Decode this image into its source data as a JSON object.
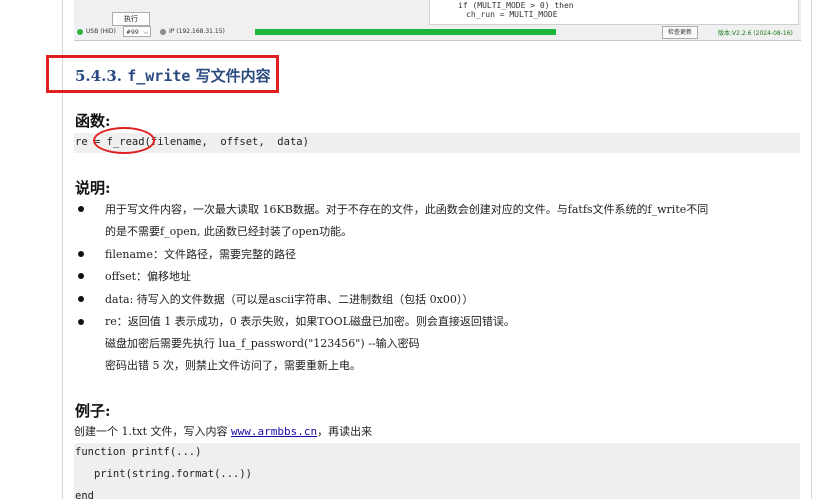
{
  "screenshot": {
    "execute_button": "执行",
    "code_lines": [
      "if (MULTI_MODE > 0) then",
      "ch_run = MULTI_MODE"
    ],
    "status": {
      "usb_label": "USB (HID)",
      "device_value": "#99",
      "ip_label": "IP (192.168.31.15)",
      "progress_fraction": 1.0,
      "check_update_label": "检查更新",
      "version_label": "版本:V2.2.6 (2024-08-16)",
      "usb_color": "#2bb34a",
      "ip_color": "#8a8a8a"
    }
  },
  "section": {
    "number": "5.4.3.",
    "func": "f_write",
    "title_rest": "写文件内容"
  },
  "function_heading": "函数:",
  "signature": {
    "prefix": "re = ",
    "func": "f_read",
    "args": "(filename,  offset,  data)"
  },
  "description_heading": "说明:",
  "bullets": [
    {
      "lines": [
        "用于写文件内容，一次最大读取 16KB数据。对于不存在的文件，此函数会创建对应的文件。与fatfs文件系统的f_write不同",
        "的是不需要f_open, 此函数已经封装了open功能。"
      ]
    },
    {
      "lines": [
        "filename：文件路径，需要完整的路径"
      ]
    },
    {
      "lines": [
        "offset：偏移地址"
      ]
    },
    {
      "lines": [
        "data: 待写入的文件数据（可以是ascii字符串、二进制数组（包括 0x00））"
      ]
    },
    {
      "lines": [
        "re：返回值 1 表示成功，0 表示失败，如果TOOL磁盘已加密。则会直接返回错误。",
        "磁盘加密后需要先执行 lua_f_password(\"123456\") --输入密码",
        "密码出错 5 次，则禁止文件访问了，需要重新上电。"
      ]
    }
  ],
  "example_heading": "例子:",
  "example_intro": {
    "before": "创建一个 1.txt 文件，写入内容 ",
    "link": "www.armbbs.cn",
    "after": "，再读出来"
  },
  "example_code": [
    "function printf(...)",
    "   print(string.format(...))",
    "end"
  ],
  "colors": {
    "annotation_red": "#e02020",
    "section_title_blue": "#2b4a80",
    "code_background": "#efefef",
    "link_blue": "#1a0dab",
    "progress_green": "#1db53a"
  }
}
